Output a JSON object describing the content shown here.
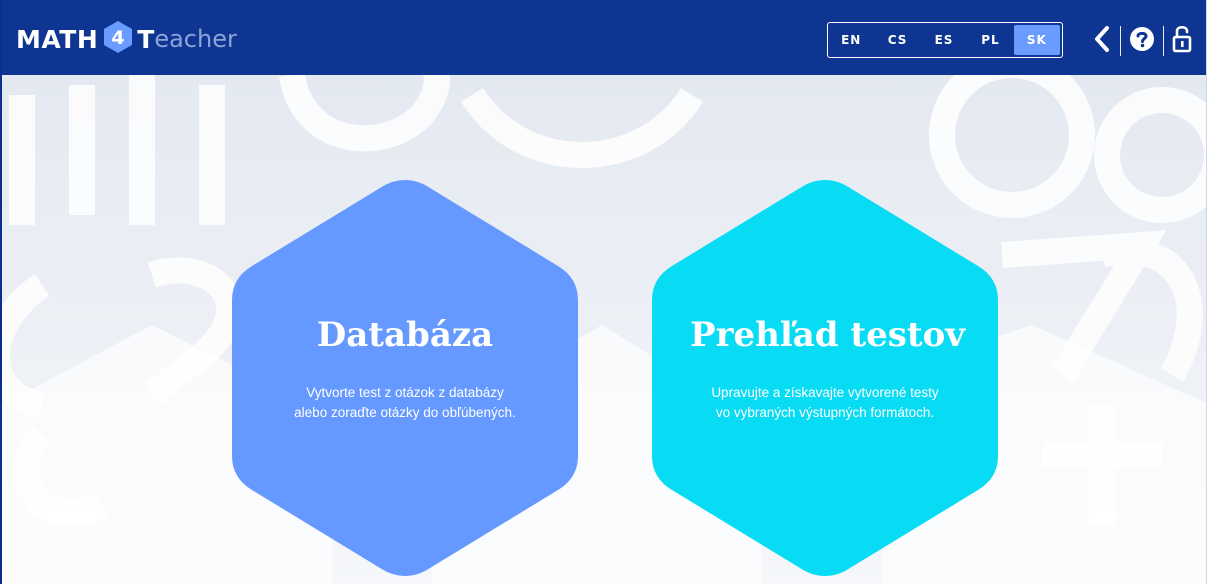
{
  "header": {
    "logo": {
      "part1": "MATH",
      "digit": "4",
      "part2_first": "T",
      "part2_rest": "eacher"
    },
    "languages": [
      "EN",
      "CS",
      "ES",
      "PL",
      "SK"
    ],
    "active_language": "SK"
  },
  "cards": [
    {
      "title": "Databáza",
      "description": "Vytvorte test z otázok z databázy alebo zoraďte otázky do obľúbených.",
      "color": "#6699ff"
    },
    {
      "title": "Prehľad testov",
      "description": "Upravujte a získavajte vytvorené testy vo vybraných výstupných formátoch.",
      "color": "#08dcf5"
    }
  ],
  "colors": {
    "header_bg": "#0d3591",
    "active_lang_bg": "#6a9cff"
  },
  "icons": [
    "back-chevron-icon",
    "help-icon",
    "unlock-icon"
  ]
}
